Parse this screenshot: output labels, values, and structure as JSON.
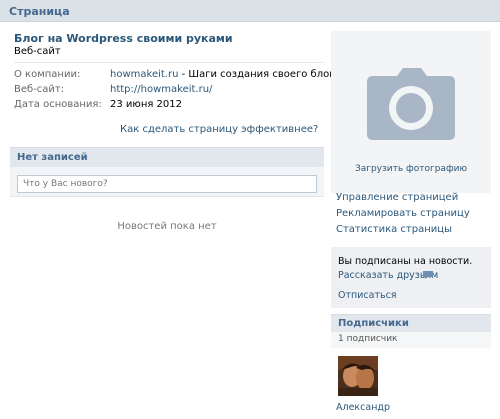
{
  "header": {
    "title": "Страница"
  },
  "page": {
    "name": "Блог на Wordpress своими руками",
    "type": "Веб-сайт"
  },
  "info": [
    {
      "label": "О компании:",
      "link": "howmakeit.ru",
      "text": " - Шаги создания своего блога!"
    },
    {
      "label": "Веб-сайт:",
      "link": "http://howmakeit.ru/"
    },
    {
      "label": "Дата основания:",
      "text": "23 июня 2012"
    }
  ],
  "effective_link": "Как сделать страницу эффективнее?",
  "wall": {
    "title": "Нет записей",
    "placeholder": "Что у Вас нового?",
    "empty_text": "Новостей пока нет"
  },
  "photo": {
    "upload_label": "Загрузить фотографию",
    "icon": "camera-icon",
    "icon_bg": "#a9b6c6"
  },
  "menu": [
    {
      "label": "Управление страницей"
    },
    {
      "label": "Рекламировать страницу"
    },
    {
      "label": "Статистика страницы"
    }
  ],
  "subscription": {
    "status": "Вы подписаны на новости.",
    "tell_friends": "Рассказать друзьям",
    "unsubscribe": "Отписаться"
  },
  "subscribers": {
    "title": "Подписчики",
    "count": "1 подписчик",
    "items": [
      {
        "name": "Александр"
      }
    ]
  },
  "colors": {
    "link": "#2b587a",
    "header": "#45688e",
    "accent": "#dae2e8"
  }
}
